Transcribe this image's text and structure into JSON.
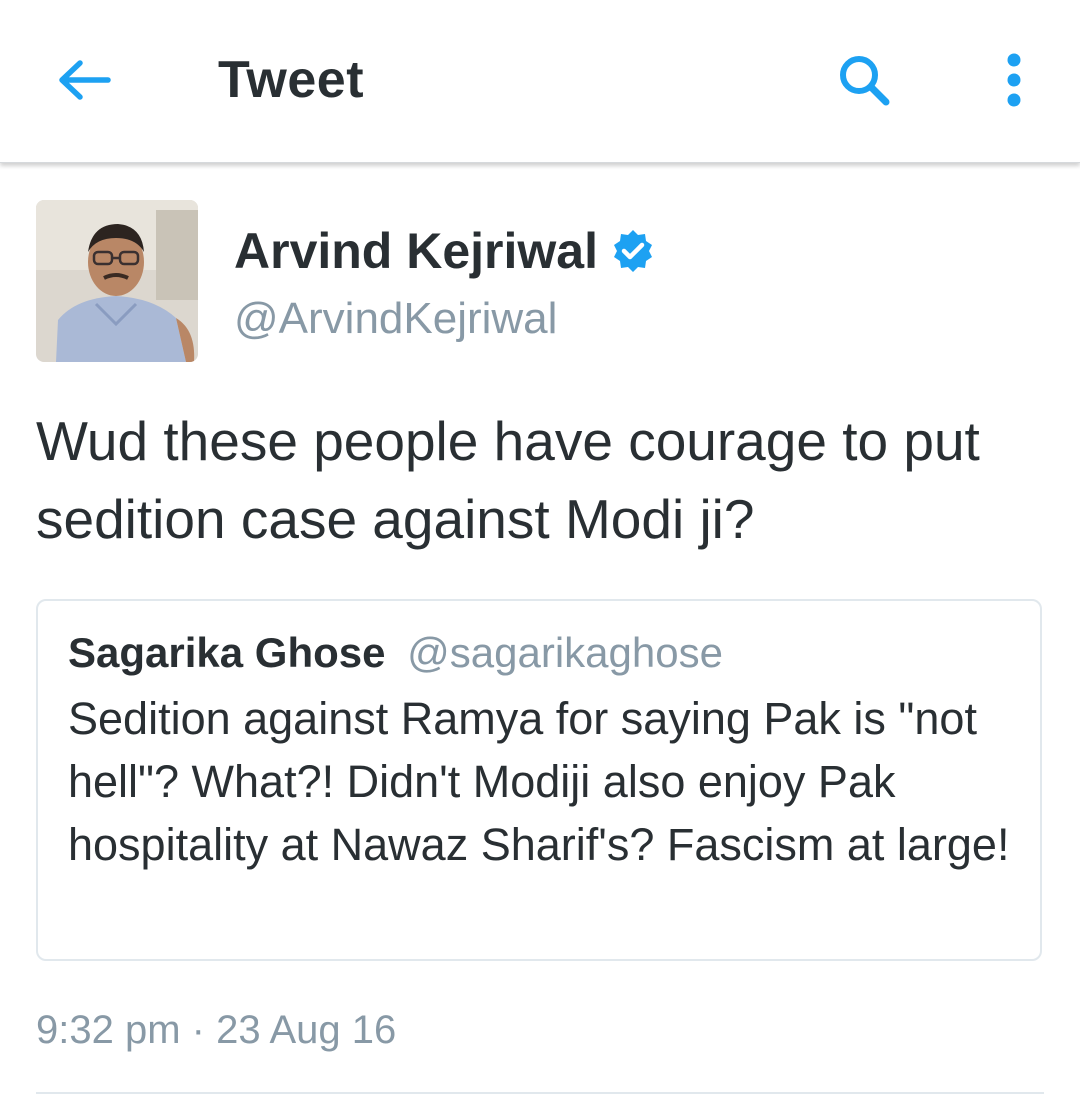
{
  "colors": {
    "accent": "#1da1f2",
    "text_primary": "#292f33",
    "text_secondary": "#8899a6",
    "border": "#e1e8ed"
  },
  "appbar": {
    "title": "Tweet",
    "back_icon": "arrow-left-icon",
    "search_icon": "search-icon",
    "more_icon": "more-vertical-icon"
  },
  "tweet": {
    "author_name": "Arvind Kejriwal",
    "author_handle": "@ArvindKejriwal",
    "verified": true,
    "verified_icon": "verified-badge-icon",
    "text": "Wud these people have courage to put sedition case against Modi ji?",
    "timestamp": "9:32 pm · 23 Aug 16"
  },
  "quoted_tweet": {
    "author_name": "Sagarika Ghose",
    "author_handle": "@sagarikaghose",
    "text": "Sedition against Ramya for saying Pak is \"not hell\"? What?! Didn't Modiji also enjoy Pak hospitality at Nawaz Sharif's? Fascism at large!"
  }
}
